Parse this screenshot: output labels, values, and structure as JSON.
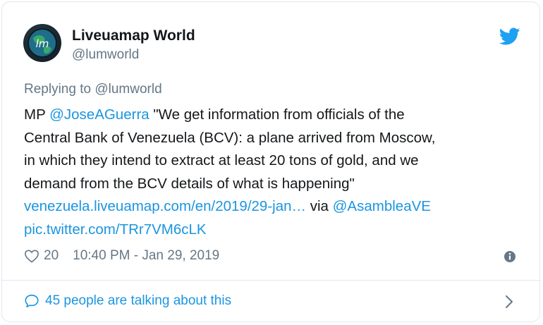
{
  "author": {
    "name": "Liveuamap World",
    "handle": "@lumworld"
  },
  "reply": {
    "prefix": "Replying to ",
    "handle": "@lumworld"
  },
  "tweet": {
    "line1_prefix": "MP ",
    "line1_mention": "@JoseAGuerra",
    "line1_rest": " \"We get information from officials of the",
    "line2": "Central Bank of Venezuela (BCV): a plane arrived from Moscow,",
    "line3": "in which they intend to extract at least 20 tons of gold, and we",
    "line4": "demand from the BCV details of what is happening\"",
    "link_url": "venezuela.liveuamap.com/en/2019/29-jan…",
    "via_text": " via ",
    "via_mention": "@AsambleaVE",
    "pic_link": "pic.twitter.com/TRr7VM6cLK"
  },
  "meta": {
    "like_count": "20",
    "timestamp": "10:40 PM - Jan 29, 2019"
  },
  "footer": {
    "talking_text": "45 people are talking about this"
  },
  "colors": {
    "link": "#1b95e0",
    "secondary_text": "#657786",
    "primary_text": "#14171a",
    "border": "#e1e8ed"
  },
  "icons": {
    "logo": "twitter-bird-icon",
    "like": "heart-icon",
    "info": "info-icon",
    "conversation": "speech-bubble-icon",
    "expand": "chevron-right-icon"
  }
}
